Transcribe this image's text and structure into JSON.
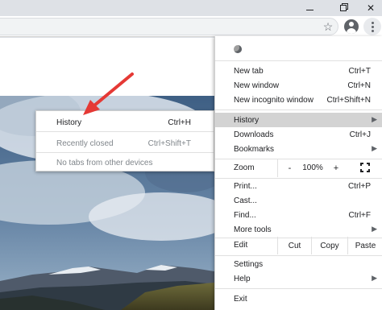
{
  "chrome": {
    "window_controls": [
      "minimize",
      "maximize",
      "close"
    ],
    "toolbar_icons": [
      "star-icon",
      "avatar-icon",
      "kebab-menu-icon"
    ]
  },
  "history_submenu": {
    "history": {
      "label": "History",
      "shortcut": "Ctrl+H"
    },
    "recently_closed": {
      "label": "Recently closed",
      "shortcut": "Ctrl+Shift+T"
    },
    "no_tabs": {
      "label": "No tabs from other devices"
    }
  },
  "menu": {
    "new_tab": {
      "label": "New tab",
      "shortcut": "Ctrl+T"
    },
    "new_window": {
      "label": "New window",
      "shortcut": "Ctrl+N"
    },
    "new_incognito": {
      "label": "New incognito window",
      "shortcut": "Ctrl+Shift+N"
    },
    "history": {
      "label": "History"
    },
    "downloads": {
      "label": "Downloads",
      "shortcut": "Ctrl+J"
    },
    "bookmarks": {
      "label": "Bookmarks"
    },
    "zoom": {
      "label": "Zoom",
      "minus": "-",
      "value": "100%",
      "plus": "+"
    },
    "print": {
      "label": "Print...",
      "shortcut": "Ctrl+P"
    },
    "cast": {
      "label": "Cast..."
    },
    "find": {
      "label": "Find...",
      "shortcut": "Ctrl+F"
    },
    "more_tools": {
      "label": "More tools"
    },
    "edit": {
      "label": "Edit",
      "cut": "Cut",
      "copy": "Copy",
      "paste": "Paste"
    },
    "settings": {
      "label": "Settings"
    },
    "help": {
      "label": "Help"
    },
    "exit": {
      "label": "Exit"
    }
  },
  "colors": {
    "active_item_bg": "#d3d3d3",
    "arrow": "#e53935",
    "disabled_text": "#80868b"
  }
}
